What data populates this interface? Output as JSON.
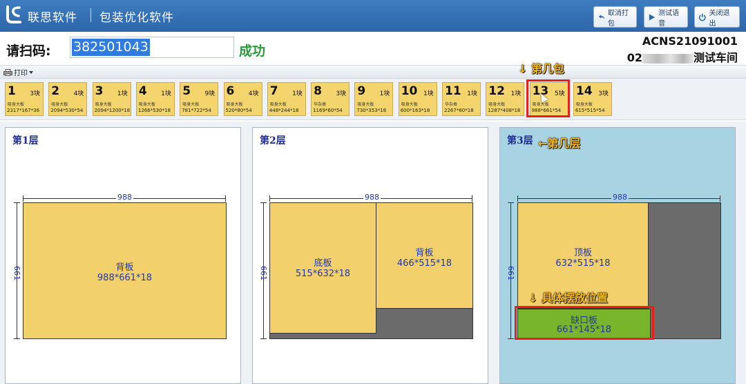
{
  "app": {
    "brand": "联思软件",
    "title": "包装优化软件"
  },
  "toolbar": {
    "cancel_label": "取消打包",
    "test_voice_label": "测试语音",
    "exit_label": "关闭退出"
  },
  "scan": {
    "label": "请扫码:",
    "value": "382501043",
    "status": "成功"
  },
  "station": {
    "code": "ACNS21091001",
    "workshop_prefix": "02",
    "workshop_suffix": "测试车间"
  },
  "printbar": {
    "print_label": "打印"
  },
  "packages": [
    {
      "num": "1",
      "count": "3块",
      "type": "吸身大板",
      "dims": "2317*167*36"
    },
    {
      "num": "2",
      "count": "4块",
      "type": "吸身大板",
      "dims": "2094*530*54"
    },
    {
      "num": "3",
      "count": "1块",
      "type": "吸身大板",
      "dims": "2094*1200*18"
    },
    {
      "num": "4",
      "count": "1块",
      "type": "吸身大板",
      "dims": "1266*530*18"
    },
    {
      "num": "5",
      "count": "9块",
      "type": "吸身大板",
      "dims": "781*722*54"
    },
    {
      "num": "6",
      "count": "4块",
      "type": "吸身大板",
      "dims": "520*80*54"
    },
    {
      "num": "7",
      "count": "1块",
      "type": "吸身大板",
      "dims": "448*244*18"
    },
    {
      "num": "8",
      "count": "3块",
      "type": "华杂类",
      "dims": "1169*60*54"
    },
    {
      "num": "9",
      "count": "1块",
      "type": "吸身大板",
      "dims": "730*353*18"
    },
    {
      "num": "10",
      "count": "1块",
      "type": "吸身大板",
      "dims": "600*163*18"
    },
    {
      "num": "11",
      "count": "1块",
      "type": "华杂类",
      "dims": "2267*60*18"
    },
    {
      "num": "12",
      "count": "1块",
      "type": "吸身大板",
      "dims": "1287*408*18"
    },
    {
      "num": "13",
      "count": "5块",
      "type": "吸身大板",
      "dims": "988*661*54"
    },
    {
      "num": "14",
      "count": "3块",
      "type": "吸身大板",
      "dims": "615*515*54"
    }
  ],
  "annotations": {
    "which_package": "↓ 第几包",
    "which_layer": "←第几层",
    "placement": "↓ 具体摆放位置"
  },
  "layers": [
    {
      "title": "第1层",
      "width_label": "988",
      "height_label": "661",
      "pieces": [
        {
          "name": "背板",
          "size": "988*661*18"
        }
      ]
    },
    {
      "title": "第2层",
      "width_label": "988",
      "height_label": "661",
      "pieces": [
        {
          "name": "底板",
          "size": "515*632*18"
        },
        {
          "name": "背板",
          "size": "466*515*18"
        }
      ]
    },
    {
      "title": "第3层",
      "width_label": "988",
      "height_label": "661",
      "pieces": [
        {
          "name": "顶板",
          "size": "632*515*18"
        },
        {
          "name": "缺口板",
          "size": "661*145*18"
        }
      ]
    }
  ],
  "colors": {
    "titlebar": "#2c66ab",
    "piece_yellow": "#f2d06b",
    "piece_green": "#79b52a",
    "highlight_red": "#e8201b",
    "annotation_gold": "#f3b81f",
    "active_layer": "#a8d3e3",
    "status_green": "#2a9a3a"
  },
  "icons": [
    "logo-icon",
    "undo-icon",
    "play-icon",
    "power-icon",
    "printer-icon",
    "chevron-down-icon",
    "cursor-icon"
  ]
}
